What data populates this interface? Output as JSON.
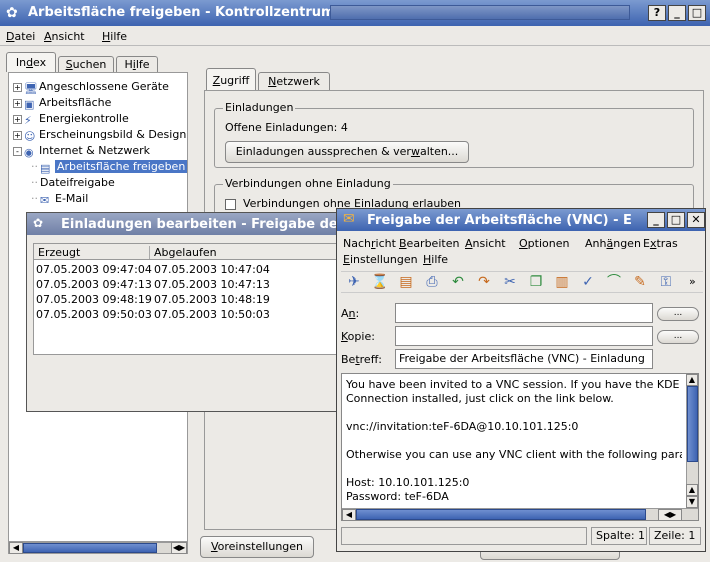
{
  "main_window": {
    "title": "Arbeitsfläche freigeben - Kontrollzentrum",
    "menu": [
      {
        "pre": "",
        "u": "D",
        "post": "atei"
      },
      {
        "pre": "",
        "u": "A",
        "post": "nsicht"
      },
      {
        "pre": "",
        "u": "H",
        "post": "ilfe"
      }
    ],
    "side_tabs": {
      "index": {
        "pre": "In",
        "u": "d",
        "post": "ex"
      },
      "search": {
        "pre": "",
        "u": "S",
        "post": "uchen"
      },
      "help": {
        "pre": "H",
        "u": "i",
        "post": "lfe"
      }
    },
    "tree": [
      {
        "label": "Angeschlossene Geräte",
        "icon": "monitor-icon",
        "indent": 0,
        "exp": "+"
      },
      {
        "label": "Arbeitsfläche",
        "icon": "desktop-icon",
        "indent": 0,
        "exp": "+"
      },
      {
        "label": "Energiekontrolle",
        "icon": "power-icon",
        "indent": 0,
        "exp": "+"
      },
      {
        "label": "Erscheinungsbild & Design",
        "icon": "appearance-icon",
        "indent": 0,
        "exp": "+"
      },
      {
        "label": "Internet & Netzwerk",
        "icon": "globe-icon",
        "indent": 0,
        "exp": "-"
      },
      {
        "label": "Arbeitsfläche freigeben",
        "icon": "share-desktop-icon",
        "indent": 1,
        "selected": true
      },
      {
        "label": "Dateifreigabe",
        "icon": "",
        "indent": 1
      },
      {
        "label": "E-Mail",
        "icon": "mail-icon",
        "indent": 1
      }
    ],
    "content_tabs": {
      "access": {
        "pre": "",
        "u": "Z",
        "post": "ugriff"
      },
      "network": {
        "pre": "",
        "u": "N",
        "post": "etzwerk"
      }
    },
    "invitations_group": {
      "title": "Einladungen",
      "open_text": "Offene Einladungen: 4",
      "button": {
        "pre": "Einladungen aussprechen & ver",
        "u": "w",
        "post": "alten..."
      }
    },
    "uninvited_group": {
      "title": "Verbindungen ohne Einladung",
      "checkbox_label": "Verbindungen ohne Einladung erlauben"
    },
    "defaults_button": {
      "pre": "",
      "u": "V",
      "post": "oreinstellungen"
    }
  },
  "invitations_dialog": {
    "title": "Einladungen bearbeiten - Freigabe der Arbeitsfläche",
    "columns": [
      "Erzeugt",
      "Abgelaufen"
    ],
    "rows": [
      [
        "07.05.2003 09:47:04",
        "07.05.2003 10:47:04"
      ],
      [
        "07.05.2003 09:47:13",
        "07.05.2003 10:47:13"
      ],
      [
        "07.05.2003 09:48:19",
        "07.05.2003 10:48:19"
      ],
      [
        "07.05.2003 09:50:03",
        "07.05.2003 10:50:03"
      ]
    ]
  },
  "mail_window": {
    "title": "Freigabe der Arbeitsfläche (VNC) - E",
    "menu_row1": [
      {
        "pre": "Nach",
        "u": "r",
        "post": "icht"
      },
      {
        "pre": "",
        "u": "B",
        "post": "earbeiten"
      },
      {
        "pre": "",
        "u": "A",
        "post": "nsicht"
      },
      {
        "pre": "",
        "u": "O",
        "post": "ptionen"
      },
      {
        "pre": "Anh",
        "u": "ä",
        "post": "ngen"
      },
      {
        "pre": "E",
        "u": "x",
        "post": "tras"
      }
    ],
    "menu_row2": [
      {
        "pre": "",
        "u": "E",
        "post": "instellungen"
      },
      {
        "pre": "",
        "u": "H",
        "post": "ilfe"
      }
    ],
    "toolbar_icons": [
      "send-icon",
      "send-later-icon",
      "save-icon",
      "print-icon",
      "undo-icon",
      "redo-icon",
      "cut-icon",
      "copy-icon",
      "paste-icon",
      "spellcheck-icon",
      "attach-icon",
      "sign-icon",
      "encrypt-icon"
    ],
    "to_label": {
      "pre": "A",
      "u": "n",
      "post": ":"
    },
    "cc_label": {
      "pre": "",
      "u": "K",
      "post": "opie:"
    },
    "subject_label": {
      "pre": "Be",
      "u": "t",
      "post": "reff:"
    },
    "to_value": "",
    "cc_value": "",
    "subject_value": "Freigabe der Arbeitsfläche (VNC) - Einladung",
    "browse_label": "...",
    "body_lines": [
      "You have been invited to a VNC session. If you have the KDE Remote Desktop",
      "Connection installed, just click on the link below.",
      "",
      "vnc://invitation:teF-6DA@10.10.101.125:0",
      "",
      "Otherwise you can use any VNC client with the following parameters:",
      "",
      "Host: 10.10.101.125:0",
      "Password: teF-6DA"
    ],
    "status_col": "Spalte: 1",
    "status_line": "Zeile: 1"
  },
  "colors": {
    "title_active": "#3d63b0",
    "selection": "#4a76c6"
  }
}
